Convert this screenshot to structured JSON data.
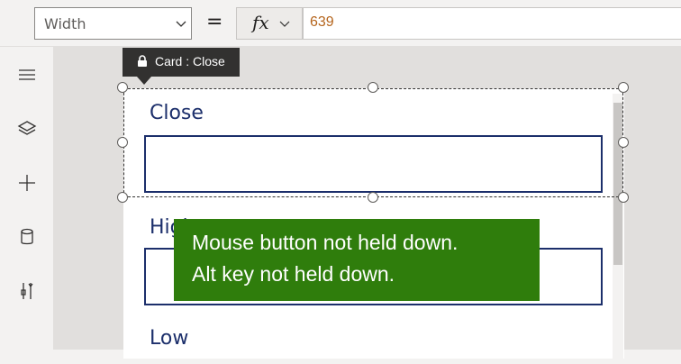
{
  "formula_bar": {
    "property": "Width",
    "equals": "=",
    "fx": "fx",
    "formula": "639"
  },
  "left_rail": {
    "icons": [
      "hamburger-menu-icon",
      "layers-icon",
      "plus-icon",
      "database-icon",
      "tools-icon"
    ]
  },
  "canvas": {
    "tooltip": "Card : Close",
    "fields": [
      {
        "label": "Close"
      },
      {
        "label": "High"
      },
      {
        "label": "Low"
      }
    ],
    "overlay": {
      "line1": "Mouse button not held down.",
      "line2": "Alt key not held down."
    }
  },
  "colors": {
    "label_text": "#1c2f6b",
    "overlay_bg": "#2f7d0c",
    "formula_value": "#b5651d"
  }
}
